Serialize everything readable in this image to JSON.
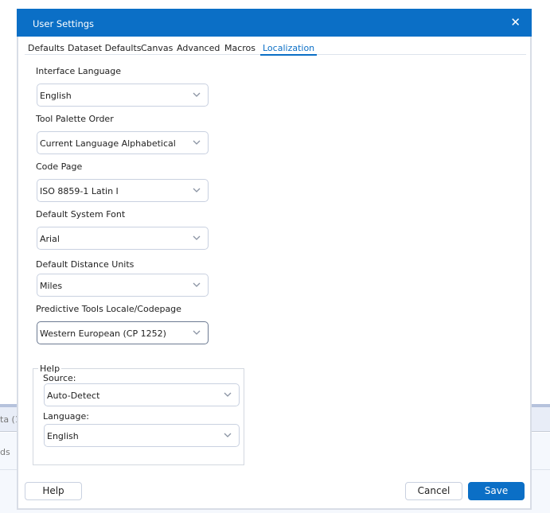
{
  "background": {
    "text1": "ta (1",
    "text2": "ds"
  },
  "dialog": {
    "title": "User Settings",
    "close_icon": "close-icon",
    "tabs": [
      {
        "label": "Defaults"
      },
      {
        "label": "Dataset Defaults"
      },
      {
        "label": "Canvas"
      },
      {
        "label": "Advanced"
      },
      {
        "label": "Macros"
      },
      {
        "label": "Localization",
        "active": true
      }
    ],
    "fields": {
      "interface_language": {
        "label": "Interface Language",
        "value": "English"
      },
      "tool_palette_order": {
        "label": "Tool Palette Order",
        "value": "Current Language Alphabetical"
      },
      "code_page": {
        "label": "Code Page",
        "value": "ISO 8859-1 Latin I"
      },
      "default_system_font": {
        "label": "Default System Font",
        "value": "Arial"
      },
      "default_distance_units": {
        "label": "Default Distance Units",
        "value": "Miles"
      },
      "predictive_locale": {
        "label": "Predictive Tools Locale/Codepage",
        "value": "Western European (CP 1252)"
      }
    },
    "help_group": {
      "legend": "Help",
      "source": {
        "label": "Source:",
        "value": "Auto-Detect"
      },
      "language": {
        "label": "Language:",
        "value": "English"
      }
    },
    "buttons": {
      "help": "Help",
      "cancel": "Cancel",
      "save": "Save"
    },
    "colors": {
      "accent": "#0b6fc6"
    }
  }
}
